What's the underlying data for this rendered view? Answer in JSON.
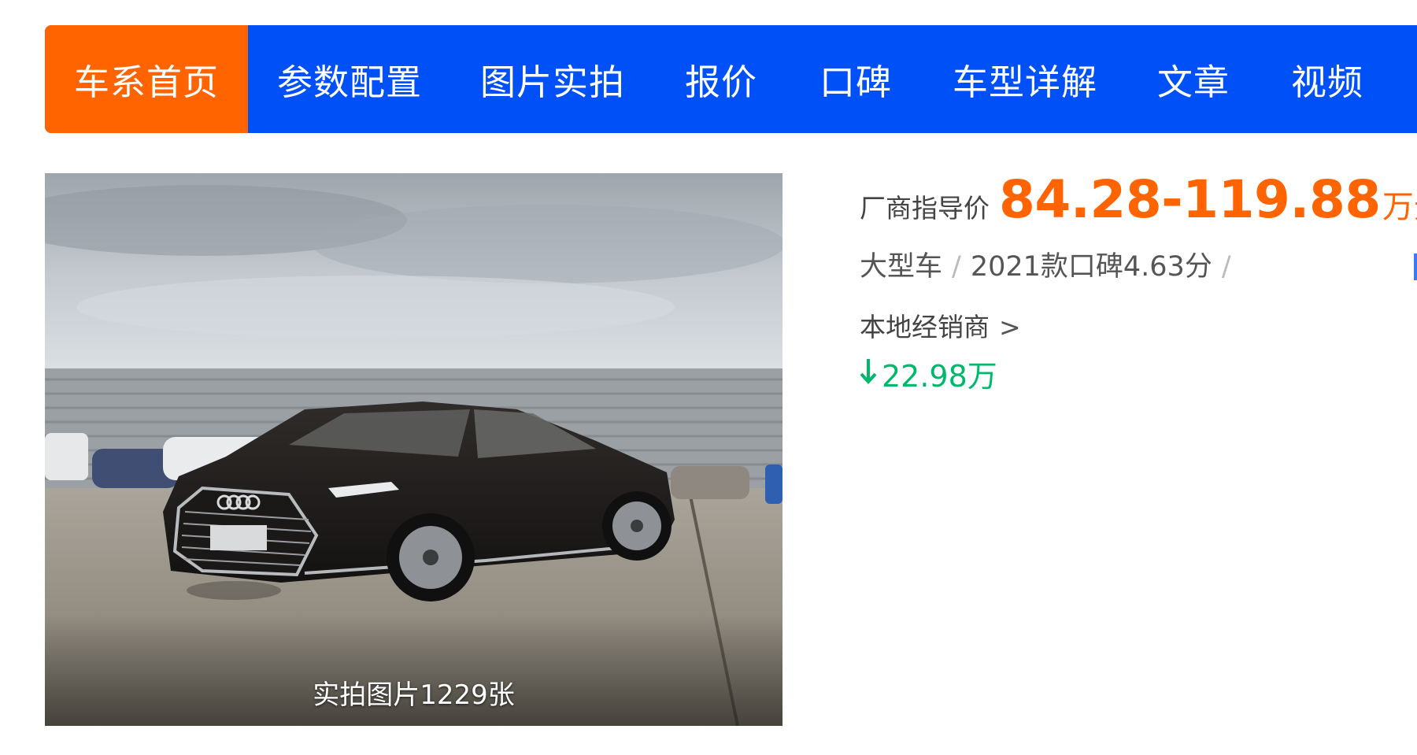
{
  "nav": {
    "tabs": [
      {
        "label": "车系首页",
        "active": true
      },
      {
        "label": "参数配置",
        "active": false
      },
      {
        "label": "图片实拍",
        "active": false
      },
      {
        "label": "报价",
        "active": false
      },
      {
        "label": "口碑",
        "active": false
      },
      {
        "label": "车型详解",
        "active": false
      },
      {
        "label": "文章",
        "active": false
      },
      {
        "label": "视频",
        "active": false
      }
    ],
    "colors": {
      "bar": "#0050f7",
      "active": "#ff6400"
    }
  },
  "photo": {
    "caption": "实拍图片1229张"
  },
  "info": {
    "price_label": "厂商指导价",
    "price_range": "84.28-119.88",
    "price_unit": "万元",
    "meta": {
      "category": "大型车",
      "separator": "/",
      "rating": "2021款口碑4.63分"
    },
    "dealer": {
      "label": "本地经销商",
      "chevron": ">"
    },
    "discount": {
      "icon": "down-arrow-icon",
      "value": "22.98万"
    },
    "colors": {
      "price": "#ff6400",
      "discount": "#00b86b"
    }
  }
}
